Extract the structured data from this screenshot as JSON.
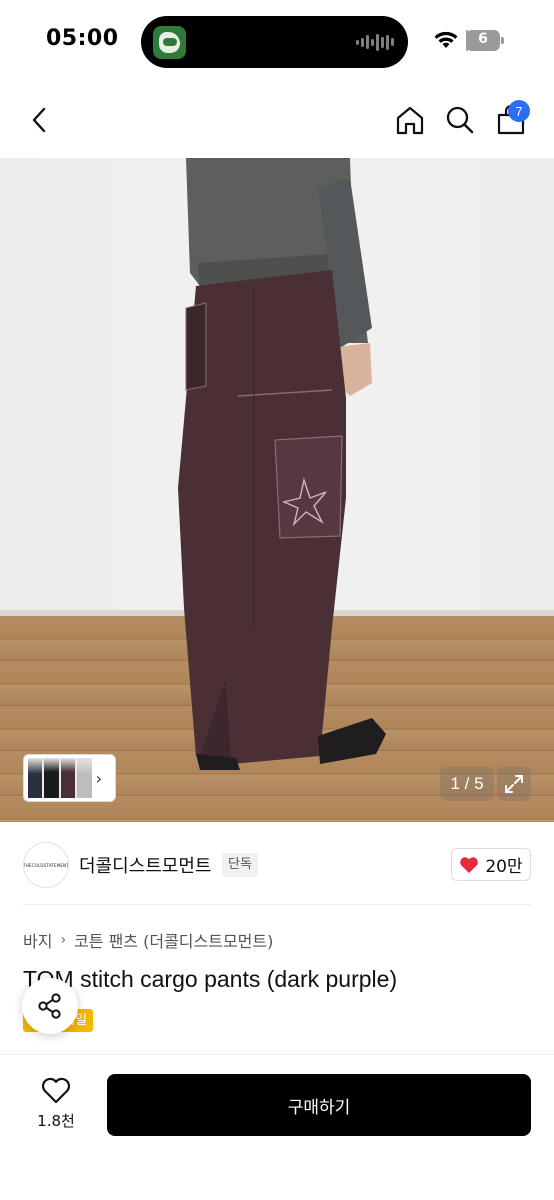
{
  "status_bar": {
    "time": "05:00",
    "battery": "6",
    "battery_fraction": 0.06
  },
  "nav": {
    "cart_count": "7",
    "icons": [
      "back-arrow-icon",
      "home-icon",
      "search-icon",
      "shopping-bag-icon"
    ]
  },
  "gallery": {
    "counter": "1 / 5",
    "thumb_chevron": "›"
  },
  "brand": {
    "logo_text": "THECOLDSTATEMENT",
    "name": "더콜디스트모먼트",
    "tag": "단독",
    "likes": "20만"
  },
  "breadcrumb": {
    "items": [
      "바지",
      "코튼 팬츠 (더콜디스트모먼트)"
    ],
    "separator": "›"
  },
  "product": {
    "title": "TOM stitch cargo pants (dark purple)",
    "sale_badge": "세일"
  },
  "bottom_bar": {
    "wish_count": "1.8천",
    "buy_label": "구매하기"
  },
  "colors": {
    "badge_blue": "#2b6ef3",
    "heart_red": "#e8283c",
    "sale_yellow": "#f7b500",
    "buy_black": "#000000"
  }
}
